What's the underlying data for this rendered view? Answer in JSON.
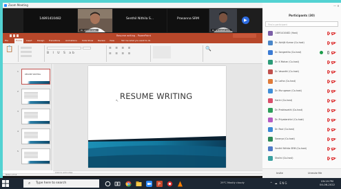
{
  "titlebar": {
    "title": "Zoom Meeting"
  },
  "video_tiles": [
    {
      "name": "14891410482"
    },
    {
      "name": "Senthil Nithila S..."
    },
    {
      "name": "Prasanna SRM"
    }
  ],
  "camera_tags": [
    "Dr. Abhijit Shal..",
    "Dr. K ScallaH Kim"
  ],
  "ppt": {
    "title": "Resume writing - PowerPoint",
    "tabs": [
      "File",
      "Home",
      "Insert",
      "Design",
      "Transitions",
      "Animations",
      "Slide Show",
      "Review",
      "View",
      "Tell me what you want to do"
    ],
    "slide_title": "RESUME WRITING",
    "notes_placeholder": "Click to add notes",
    "status": "Slide 1 of 14"
  },
  "participants": {
    "header": "Participants (30)",
    "find_placeholder": "Find a participant",
    "list": [
      {
        "name": "14891410482 (Host)",
        "color": "#7b5ea7",
        "mic_on": false
      },
      {
        "name": "Dr. Abhijit Kumar (Co-host)",
        "color": "#4a86c8",
        "mic_on": false
      },
      {
        "name": "Dr. Sangeetha (Co-host)",
        "color": "#3b7bd4",
        "mic_on": true,
        "active": true
      },
      {
        "name": "Dr. K Mohan (Co-host)",
        "color": "#2b9b78",
        "mic_on": false
      },
      {
        "name": "Dr. Vasanthi (Co-host)",
        "color": "#c0504d",
        "mic_on": false
      },
      {
        "name": "Dr. Latha (Co-host)",
        "color": "#e07b39",
        "mic_on": false
      },
      {
        "name": "Dr. Murugesan (Co-host)",
        "color": "#3f8ed8",
        "mic_on": false
      },
      {
        "name": "Harini (Co-host)",
        "color": "#d94f6a",
        "mic_on": false
      },
      {
        "name": "Dr. Prabhavathi (Co-host)",
        "color": "#2c9e5a",
        "mic_on": false
      },
      {
        "name": "Dr. Priyadarshini (Co-host)",
        "color": "#b55cc2",
        "mic_on": false
      },
      {
        "name": "Dr. Ravi (Co-host)",
        "color": "#3a88d5",
        "mic_on": false
      },
      {
        "name": "Saranya (Co-host)",
        "color": "#2e8b57",
        "mic_on": false
      },
      {
        "name": "Senthil Nithila SRM (Co-host)",
        "color": "#4e7ac7",
        "mic_on": false
      },
      {
        "name": "Shalini (Co-host)",
        "color": "#3aa0a0",
        "mic_on": false
      }
    ],
    "footer_invite": "Invite",
    "footer_mute": "Unmute Me"
  },
  "taskbar": {
    "search_placeholder": "Type here to search",
    "weather": "29°C Mostly cloudy",
    "tray": "^ ☁ ENG",
    "time": "09:19 PM",
    "date": "04-06-2022"
  },
  "colors": {
    "ppt_accent": "#b7472a",
    "zoom_blue": "#2d8cff",
    "desktop": "#53d2d2"
  }
}
